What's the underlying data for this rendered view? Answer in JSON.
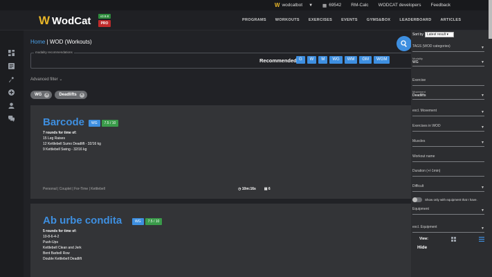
{
  "topbar": {
    "user": "wodcatbot",
    "points": "69542",
    "rmcalc": "RM-Calc",
    "devs": "WODCAT developers",
    "feedback": "Feedback"
  },
  "brand": {
    "name": "WodCat",
    "version": "v3.9.8",
    "pro": "PRO"
  },
  "nav": [
    "PROGRAMS",
    "WORKOUTS",
    "EXERCISES",
    "EVENTS",
    "GYMS&BOX",
    "LEADERBOARD",
    "ARTICLES"
  ],
  "breadcrumb": {
    "home": "Home",
    "sep": " | ",
    "current": "WOD (Workouts)"
  },
  "modality": {
    "legend": "modality recommendations",
    "recommended_label": "Recommended:",
    "options": [
      "G",
      "W",
      "M",
      "WG",
      "WM",
      "GM",
      "WGM"
    ]
  },
  "advanced_filter": "Advanced filter",
  "chips": [
    "WG",
    "Deadlifts"
  ],
  "cards": [
    {
      "title": "Barcode",
      "modality": "WG",
      "rating": "7.5 / 10",
      "head": "7 rounds for time of:",
      "lines": [
        "15 Leg Raises",
        "12 Kettlebell Sumo Deadlift - 32/16 kg",
        "9 Kettlebell Swing - 32/16 kg"
      ],
      "tags": "Personal | Couplet | For-Time | Kettlebell",
      "duration": "10m:16s",
      "count": "6"
    },
    {
      "title": "Ab urbe condita",
      "modality": "WG",
      "rating": "7.5 / 10",
      "head": "5 rounds for time of:",
      "lines": [
        "10-8-6-4-2",
        "Push-Ups",
        "Kettlebell Clean and Jerk",
        "Bent Barbell Row",
        "Double Kettlebell Deadlift"
      ]
    }
  ],
  "panel": {
    "sort_label": "Sort by",
    "sort_value": "Latest result",
    "tags": "TAGS (WOD categories)",
    "modality_label": "Modality",
    "modality_value": "WG",
    "exercise": "Exercise",
    "movement_label": "Movement",
    "movement_value": "Deadlifts",
    "excl_movement": "excl. Movement",
    "exercises_in_wod": "Exercises in WOD",
    "muscles": "Muscles",
    "workout_name": "Workout name",
    "duration": "Duration (+/-1min)",
    "difficult": "Difficult",
    "equip_toggle": "Show only with equipment that I have.",
    "equipment": "Equipment",
    "excl_equipment": "excl. Equipment",
    "view": "View:",
    "hide": "Hide"
  }
}
